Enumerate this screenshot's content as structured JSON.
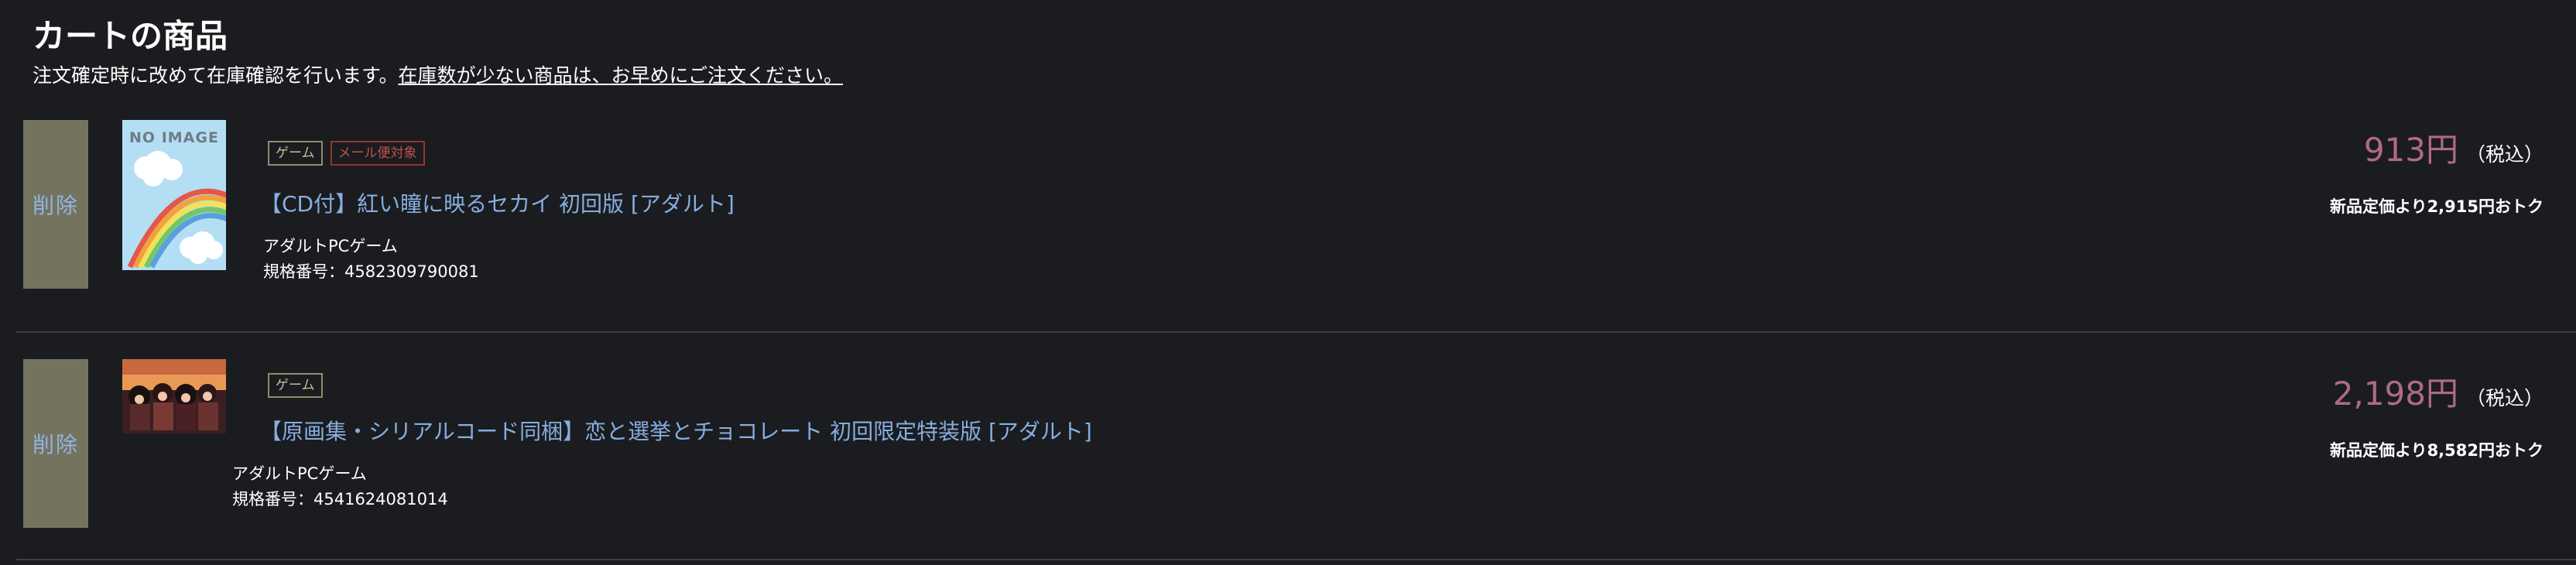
{
  "page": {
    "title": "カートの商品",
    "notice_prefix": "注文確定時に改めて在庫確認を行います。",
    "notice_emphasis": "在庫数が少ない商品は、お早めにご注文ください。"
  },
  "cart": {
    "items": [
      {
        "delete_label": "削除",
        "image_label": "NO IMAGE",
        "tags": [
          "ゲーム",
          "メール便対象"
        ],
        "title": "【CD付】紅い瞳に映るセカイ 初回版 [アダルト]",
        "category": "アダルトPCゲーム",
        "spec_number": "規格番号：4582309790081",
        "price": "913円",
        "tax_label": "（税込）",
        "discount_note": "新品定価より2,915円おトク"
      },
      {
        "delete_label": "削除",
        "tags": [
          "ゲーム"
        ],
        "title": "【原画集・シリアルコード同梱】恋と選挙とチョコレート 初回限定特装版 [アダルト]",
        "category": "アダルトPCゲーム",
        "spec_number": "規格番号：4541624081014",
        "price": "2,198円",
        "tax_label": "（税込）",
        "discount_note": "新品定価より8,582円おトク"
      }
    ]
  },
  "colors": {
    "background": "#1b1c1f",
    "delete_button": "#74735e",
    "link": "#86aee0",
    "price": "#b06a88",
    "tag_game": "#8c8e6e",
    "tag_mail": "#8f3633"
  }
}
